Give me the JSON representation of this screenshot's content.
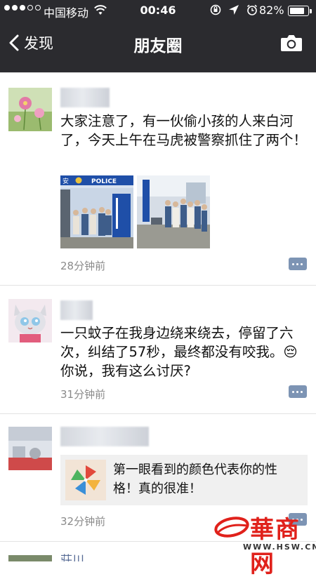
{
  "status_bar": {
    "carrier": "中国移动",
    "time": "00:46",
    "battery": "82%",
    "battery_level": 0.82,
    "signal_bars_filled": 3,
    "signal_bars_total": 5
  },
  "nav": {
    "back_label": "发现",
    "title": "朋友圈"
  },
  "posts": [
    {
      "text": "大家注意了，有一伙偷小孩的人来白河了，今天上午在马虎被警察抓住了两个！",
      "photo_sign": "POLICE",
      "photo_sign_left": "安",
      "time": "28分钟前"
    },
    {
      "text_before_emoji": "一只蚊子在我身边绕来绕去，停留了六次，纠结了57秒，最终都没有咬我。",
      "emoji": "😔",
      "text_after_emoji": "你说，我有这么讨厌?",
      "time": "31分钟前"
    },
    {
      "share_title": "第一眼看到的颜色代表你的性格！真的很准！",
      "time": "32分钟前"
    },
    {
      "name_partial": "莊川"
    }
  ],
  "watermark": {
    "text": "華商网",
    "url": "WWW.HSW.CN"
  },
  "colors": {
    "header_bg": "#2b2b2f",
    "comment_button": "#7d94b4",
    "watermark_red": "#e0211b"
  }
}
